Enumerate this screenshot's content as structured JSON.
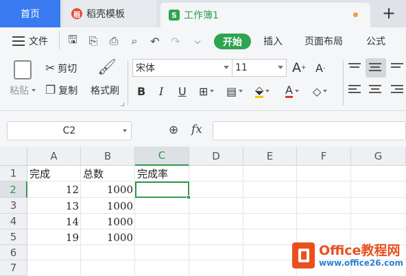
{
  "tabs": {
    "home": "首页",
    "template": "稻壳模板",
    "workbook": "工作簿1",
    "workbook_icon": "S",
    "add": "+"
  },
  "menu": {
    "file": "文件",
    "start": "开始",
    "insert": "插入",
    "page_layout": "页面布局",
    "formula": "公式"
  },
  "ribbon": {
    "paste": "粘贴",
    "cut": "剪切",
    "copy": "复制",
    "format_painter": "格式刷",
    "font_name": "宋体",
    "font_size": "11",
    "bold": "B",
    "italic": "I",
    "underline": "U",
    "font_color_letter": "A",
    "grow_font": "A",
    "shrink_font": "A"
  },
  "formula_bar": {
    "name_box": "C2",
    "fx": "fx",
    "value": ""
  },
  "sheet": {
    "columns": [
      "A",
      "B",
      "C",
      "D",
      "E",
      "F",
      "G"
    ],
    "rows": [
      "1",
      "2",
      "3",
      "4",
      "5",
      "6",
      "7"
    ],
    "selected_column": "C",
    "selected_row": "2",
    "cells": {
      "A1": "完成",
      "B1": "总数",
      "C1": "完成率",
      "A2": "12",
      "B2": "1000",
      "A3": "13",
      "B3": "1000",
      "A4": "14",
      "B4": "1000",
      "A5": "19",
      "B5": "1000"
    }
  },
  "watermark": {
    "brand": "Office教程网",
    "url": "www.office26.com"
  },
  "colors": {
    "accent_green": "#2e9a4b",
    "home_tab_blue": "#3a7af0",
    "watermark_orange": "#e8501f"
  }
}
